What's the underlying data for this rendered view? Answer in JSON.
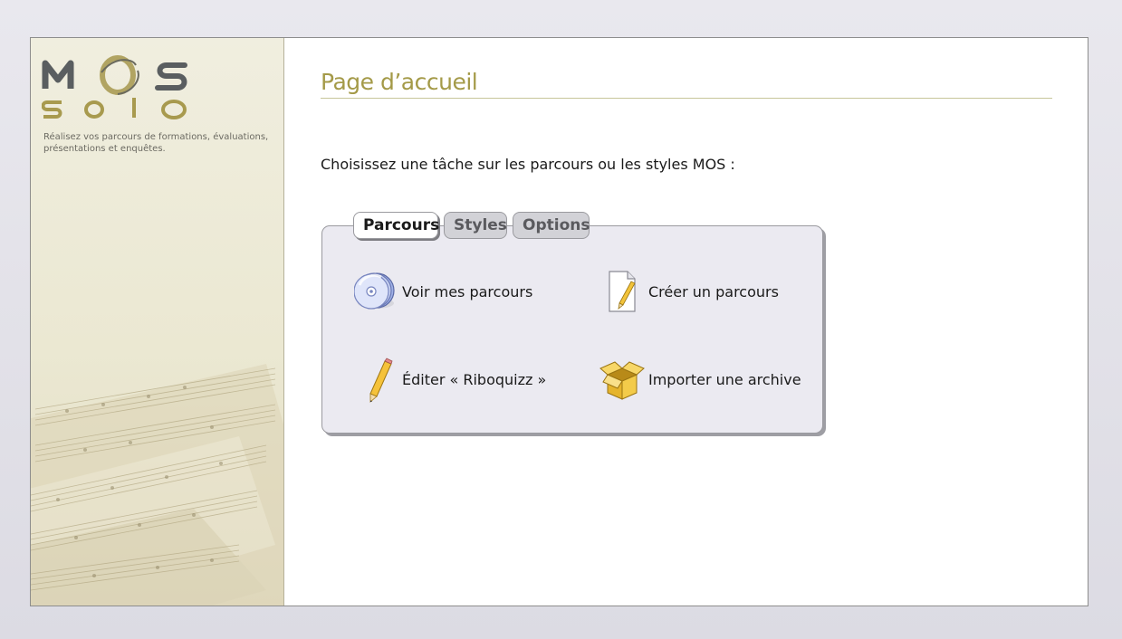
{
  "app": {
    "logo_top": "MOS",
    "logo_bottom": "solo",
    "tagline": "Réalisez vos parcours de formations, évaluations, présentations et enquêtes."
  },
  "main": {
    "title": "Page d’accueil",
    "intro": "Choisissez une tâche sur les parcours ou les styles MOS :"
  },
  "tabs": [
    {
      "label": "Parcours",
      "active": true
    },
    {
      "label": "Styles",
      "active": false
    },
    {
      "label": "Options",
      "active": false
    }
  ],
  "actions": [
    {
      "label": "Voir mes parcours",
      "icon": "cd-icon"
    },
    {
      "label": "Créer un parcours",
      "icon": "new-document-icon"
    },
    {
      "label": "Éditer « Riboquizz »",
      "icon": "pencil-icon"
    },
    {
      "label": "Importer une archive",
      "icon": "open-box-icon"
    }
  ],
  "colors": {
    "title": "#a49a48",
    "logo_grey": "#5a5e60",
    "logo_olive": "#a89a4e",
    "sidebar": "#ebe8d2",
    "panel": "#ebeaf1"
  }
}
